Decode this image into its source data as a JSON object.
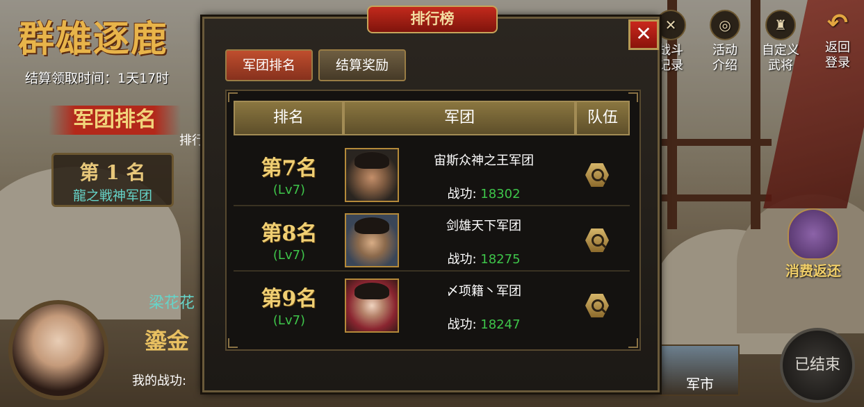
{
  "background": {
    "event_title": "群雄逐鹿",
    "settle_time": "结算领取时间：1天17时",
    "banner": "军团排名",
    "rank_label": "排行",
    "first_place": {
      "rank": "第 1 名",
      "legion": "龍之戦神军团"
    },
    "player_name": "梁花花",
    "gold_label": "鎏金",
    "my_score_label": "我的战功:"
  },
  "right_menu": [
    {
      "icon": "crossed-swords-icon",
      "label": "战斗\n记录"
    },
    {
      "icon": "activity-icon",
      "label": "活动\n介绍"
    },
    {
      "icon": "general-icon",
      "label": "自定义\n武将"
    },
    {
      "icon": "back-arrow-icon",
      "label": "返回\n登录"
    }
  ],
  "refund_label": "消费返还",
  "ended_label": "已结束",
  "market_label": "军市",
  "modal": {
    "title": "排行榜",
    "close": "✕",
    "tabs": [
      {
        "label": "军团排名",
        "active": true
      },
      {
        "label": "结算奖励",
        "active": false
      }
    ],
    "headers": {
      "rank": "排名",
      "legion": "军团",
      "team": "队伍"
    },
    "rows": [
      {
        "rank": "第7名",
        "level": "(Lv7)",
        "legion": "宙斯众神之王军团",
        "power_label": "战功:",
        "power": "18302"
      },
      {
        "rank": "第8名",
        "level": "(Lv7)",
        "legion": "剑雄天下军团",
        "power_label": "战功:",
        "power": "18275"
      },
      {
        "rank": "第9名",
        "level": "(Lv7)",
        "legion": "〆项籍丶军团",
        "power_label": "战功:",
        "power": "18247"
      }
    ]
  }
}
